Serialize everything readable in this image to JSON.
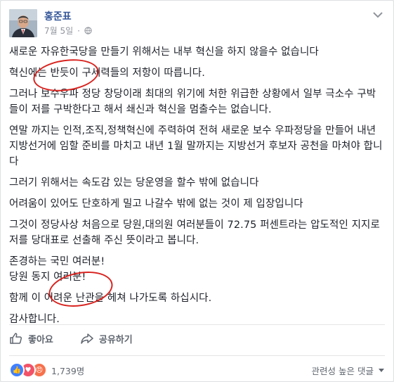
{
  "post": {
    "author": "홍준표",
    "timestamp": "7월 5일",
    "paragraphs": [
      "새로운 자유한국당을 만들기 위해서는 내부 혁신을 하지 않을수 없습니다",
      "혁신에는 반듯이 구세력들의 저항이 따릅니다.",
      "그러나 보수우파 정당 창당이래 최대의 위기에 처한 위급한 상황에서 일부 극소수 구박들이 저를 구박한다고 해서 쇄신과 혁신을 멈출수는 없습니다.",
      "연말 까지는 인적,조직,정책혁신에 주력하여 전혀 새로운 보수 우파정당을 만들어 내년 지방선거에 임할 준비를 마치고 내년 1월 말까지는 지방선거 후보자 공천을 마쳐야 합니다",
      "그러기 위해서는 속도감 있는 당운영을 할수 밖에 없습니다",
      "어려움이 있어도 단호하게 밀고 나갈수 밖에 없는 것이 제 입장입니다",
      "그것이 정당사상 처음으로 당원,대의원 여러분들이 72.75 퍼센트라는 압도적인 지지로 저를 당대표로 선출해 주신 뜻이라고 봅니다.",
      "존경하는 국민 여러분!\n당원 동지 여러분!",
      "함께 이 어려운 난관을 헤쳐 나가도록 하십시다.",
      "감사합니다."
    ]
  },
  "actions": {
    "like": "좋아요",
    "share": "공유하기"
  },
  "reactions": {
    "count": "1,739명",
    "sort_label": "관련성 높은 댓글"
  },
  "icons": {
    "privacy": "globe-icon",
    "more": "chevron-down-icon",
    "like": "thumbs-up-icon",
    "share": "share-arrow-icon"
  },
  "colors": {
    "author_link": "#365899",
    "meta": "#90949c",
    "annotation": "#d8231f",
    "like_blue": "#4080ff"
  }
}
